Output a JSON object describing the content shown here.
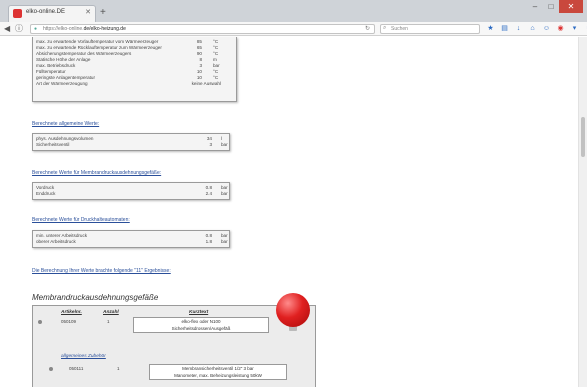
{
  "browser": {
    "tab_title": "elko-online.DE",
    "new_tab": "+",
    "url_prefix": "https://elko-online.",
    "url_domain": "de/elko-heizung.de",
    "search_placeholder": "Suchen"
  },
  "params": [
    {
      "label": "max. zu erwartende Vorlauftemperatur vom Wärmeerzeuger",
      "value": "85",
      "unit": "°C"
    },
    {
      "label": "max. zu erwartende Rücklauftemperatur zum Wärmeerzeuger",
      "value": "65",
      "unit": "°C"
    },
    {
      "label": "Absicherungstemperatur des Wärmeerzeugers",
      "value": "90",
      "unit": "°C"
    },
    {
      "label": "Statische Höhe der Anlage",
      "value": "8",
      "unit": "m"
    },
    {
      "label": "max. Betriebsdruck",
      "value": "3",
      "unit": "bar"
    },
    {
      "label": "Fülltemperatur",
      "value": "10",
      "unit": "°C"
    },
    {
      "label": "geringste Anlagentemperatur",
      "value": "10",
      "unit": "°C"
    },
    {
      "label": "Art der Wärmeerzeugung",
      "value": "keine Auswahl",
      "unit": ""
    }
  ],
  "sections": {
    "general": {
      "title": "Berechnete allgemeine Werte:",
      "rows": [
        {
          "label": "phys. Ausdehnungsvolumen",
          "value": "34",
          "unit": "l"
        },
        {
          "label": "Sicherheitsventil",
          "value": "3",
          "unit": "bar"
        }
      ]
    },
    "membrane": {
      "title": "Berechnete Werte für Membrandruckausdehnungsgefäße:",
      "rows": [
        {
          "label": "Vordruck",
          "value": "0.8",
          "unit": "bar"
        },
        {
          "label": "Enddruck",
          "value": "2.4",
          "unit": "bar"
        }
      ]
    },
    "pressure": {
      "title": "Berechnete Werte für Druckhalteautomaten:",
      "rows": [
        {
          "label": "min. unterer Arbeitsdruck",
          "value": "0.8",
          "unit": "bar"
        },
        {
          "label": "oberer Arbeitsdruck",
          "value": "1.8",
          "unit": "bar"
        }
      ]
    }
  },
  "result_link": "Die Berechnung Ihrer Werte brachte folgende \"11\" Ergebnisse:",
  "heading": "Membrandruckausdehnungsgefäße",
  "table": {
    "col_article": "Artikelnr.",
    "col_qty": "Anzahl",
    "col_text": "Kurztext",
    "rows": [
      {
        "article": "050109",
        "qty": "1",
        "text_line1": "elko-flex oder N100",
        "text_line2": "Sicherheitsdrossen/Ausgefäß"
      }
    ],
    "accessory_link": "allgemeines Zubehör",
    "accessory": [
      {
        "article": "050111",
        "qty": "1",
        "text_line1": "Membransicherheitsventil 1/2\" 3 bar",
        "text_line2": "Manometer, max. Beheizungsleistung 50kW"
      }
    ]
  },
  "colors": {
    "link": "#2a4f9a",
    "balloon": "#e02020",
    "accent": "#2c6bc3"
  }
}
